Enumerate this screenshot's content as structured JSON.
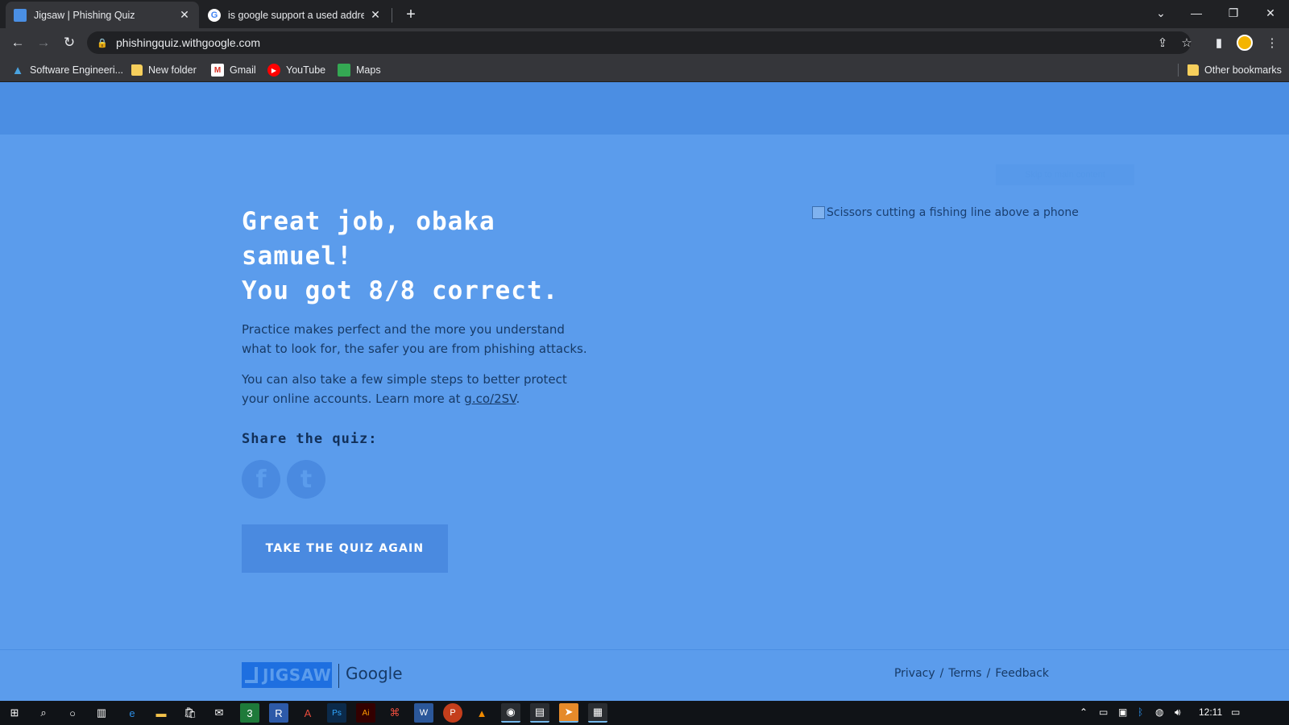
{
  "browser": {
    "tabs": [
      {
        "title": "Jigsaw | Phishing Quiz",
        "active": true,
        "favicon": "jigsaw-favicon"
      },
      {
        "title": "is google support a used addre",
        "active": false,
        "favicon": "google-favicon"
      }
    ],
    "new_tab_label": "+",
    "url": "phishingquiz.withgoogle.com",
    "bookmarks": [
      {
        "label": "Software Engineeri...",
        "icon": "software-engineering-icon"
      },
      {
        "label": "New folder",
        "icon": "folder-icon"
      },
      {
        "label": "Gmail",
        "icon": "gmail-icon"
      },
      {
        "label": "YouTube",
        "icon": "youtube-icon"
      },
      {
        "label": "Maps",
        "icon": "maps-icon"
      }
    ],
    "other_bookmarks": "Other bookmarks"
  },
  "page": {
    "skip_link": "Skip to main content",
    "headline_line1": "Great job, obaka",
    "headline_line2": "samuel!",
    "headline_line3": "You got 8/8 correct.",
    "para1": "Practice makes perfect and the more you understand what to look for, the safer you are from phishing attacks.",
    "para2_prefix": "You can also take a few simple steps to better protect your online accounts. Learn more at ",
    "para2_link": "g.co/2SV",
    "para2_suffix": ".",
    "share_label": "Share the quiz:",
    "share_facebook": "f",
    "share_twitter": "t",
    "retake_button": "TAKE THE QUIZ AGAIN",
    "image_alt": "Scissors cutting a fishing line above a phone",
    "footer": {
      "jigsaw_logo": "JIGSAW",
      "google_logo": "Google",
      "links": [
        "Privacy",
        "Terms",
        "Feedback"
      ],
      "separator": "/"
    }
  },
  "taskbar": {
    "time": "12:11"
  },
  "colors": {
    "page_bg": "#5b9cec",
    "header_bg": "#4b8ee3",
    "button_bg": "#4a8ae0"
  }
}
